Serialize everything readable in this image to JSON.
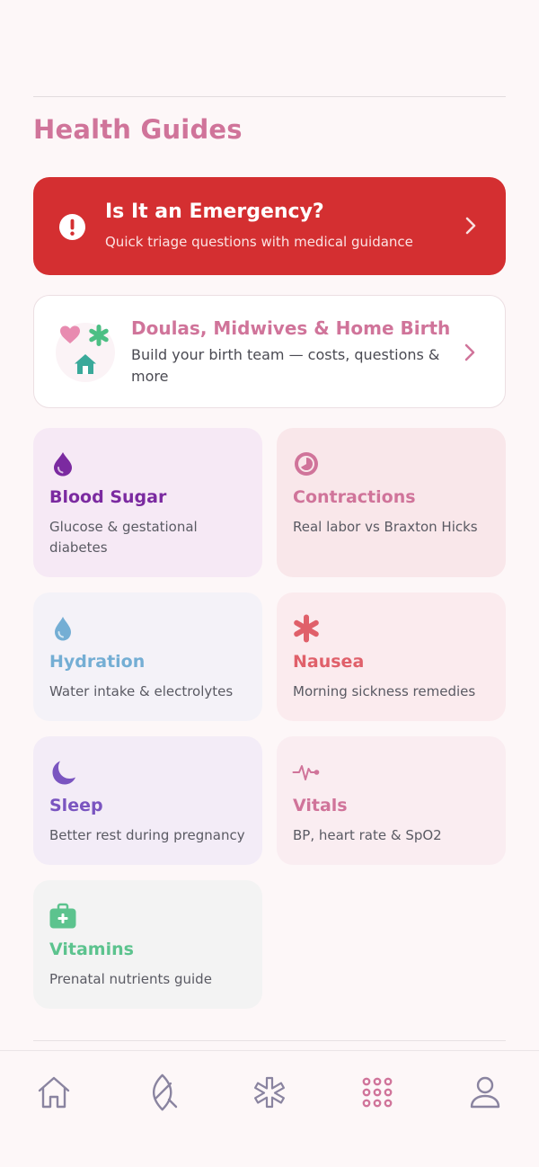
{
  "header": {
    "title": "Health Guides"
  },
  "emergency": {
    "title": "Is It an Emergency?",
    "subtitle": "Quick triage questions with medical guidance",
    "icon": "alert-circle-icon",
    "color": "#d42f31"
  },
  "doula": {
    "title": "Doulas, Midwives & Home Birth",
    "subtitle": "Build your birth team — costs, questions & more",
    "icons": [
      "heart-icon",
      "asterisk-icon",
      "house-icon"
    ]
  },
  "guides": [
    {
      "title": "Blood Sugar",
      "subtitle": "Glucose & gestational diabetes",
      "icon": "drop-icon",
      "color": "#7b2aa0"
    },
    {
      "title": "Contractions",
      "subtitle": "Real labor vs Braxton Hicks",
      "icon": "timer-icon",
      "color": "#d0749a"
    },
    {
      "title": "Hydration",
      "subtitle": "Water intake & electrolytes",
      "icon": "water-drop-icon",
      "color": "#74aed4"
    },
    {
      "title": "Nausea",
      "subtitle": "Morning sickness remedies",
      "icon": "asterisk-icon",
      "color": "#e0606a"
    },
    {
      "title": "Sleep",
      "subtitle": "Better rest during pregnancy",
      "icon": "moon-icon",
      "color": "#7a55c0"
    },
    {
      "title": "Vitals",
      "subtitle": "BP, heart rate & SpO2",
      "icon": "heartbeat-icon",
      "color": "#d0749a"
    },
    {
      "title": "Vitamins",
      "subtitle": "Prenatal nutrients guide",
      "icon": "medical-kit-icon",
      "color": "#5cc38e"
    }
  ],
  "tabbar": {
    "items": [
      "home-icon",
      "leaf-icon",
      "asterisk-icon",
      "grid-icon",
      "profile-icon"
    ],
    "active_index": 3,
    "active_color": "#d0749a",
    "inactive_color": "#8a84a0"
  }
}
